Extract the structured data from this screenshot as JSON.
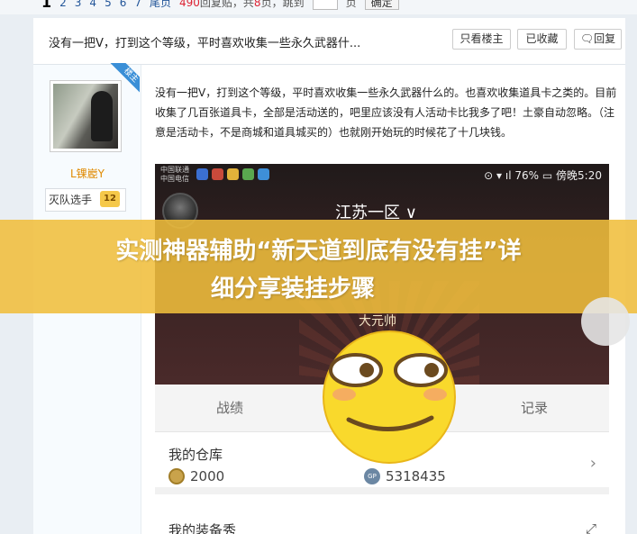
{
  "pager": {
    "current": "1",
    "pages": [
      "2",
      "3",
      "4",
      "5",
      "6",
      "7"
    ],
    "last": "尾页",
    "replies_text": "490",
    "replies_suffix": "回复贴，共",
    "pages_count": "8",
    "pages_suffix": "页，跳到",
    "page_unit": "页",
    "go_label": "确定"
  },
  "thread": {
    "title": "没有一把V，打到这个等级，平时喜欢收集一些永久武器什...",
    "buttons": {
      "only_op": "只看楼主",
      "favorite": "已收藏",
      "reply": "回复"
    }
  },
  "author": {
    "badge": "楼主",
    "name": "L锞嶏Y",
    "title": "灭队选手",
    "level": "12"
  },
  "post": {
    "text": "没有一把V，打到这个等级，平时喜欢收集一些永久武器什么的。也喜欢收集道具卡之类的。目前收集了几百张道具卡，全部是活动送的，吧里应该没有人活动卡比我多了吧！土豪自动忽略。（注意是活动卡，不是商城和道具城买的）也就刚开始玩的时候花了十几块钱。"
  },
  "phone": {
    "carrier_1": "中国联通",
    "carrier_2": "中国电信",
    "battery": "76%",
    "status_right": "傍晚5:20",
    "server": "江苏一区 ∨",
    "rank": "大元帅",
    "tab_left": "战绩",
    "tab_right": "记录",
    "warehouse_title": "我的仓库",
    "coins": "2000",
    "gp": "5318435",
    "gp_label": "GP",
    "equip_title": "我的装备秀"
  },
  "banner": {
    "line1": "实测神器辅助“新天道到底有没有挂”详",
    "line2": "细分享装挂步骤"
  },
  "colors": {
    "banner": "#f0be3c",
    "username": "#e08a00",
    "link": "#225599"
  }
}
